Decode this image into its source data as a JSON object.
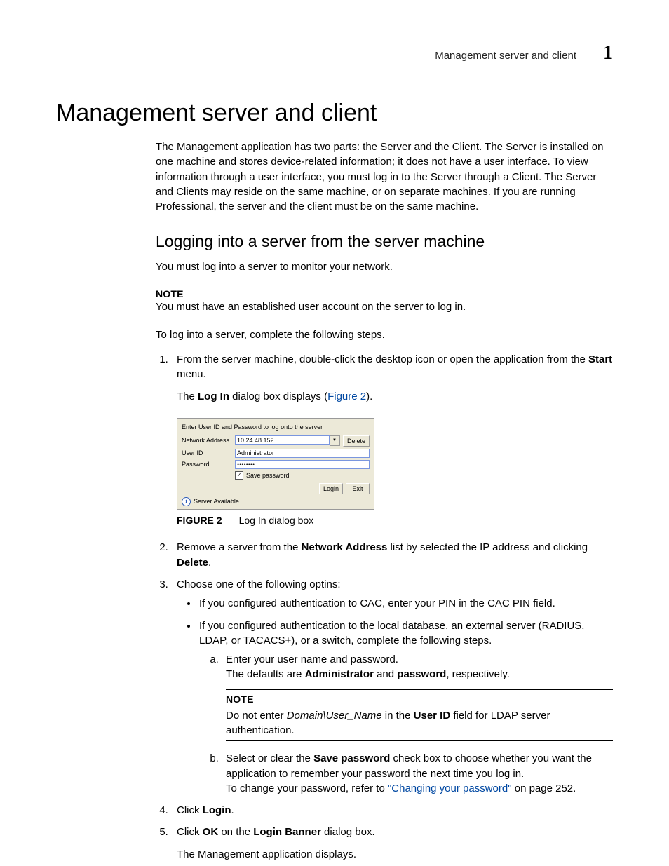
{
  "header": {
    "running_title": "Management server and client",
    "chapter_number": "1"
  },
  "title": "Management server and client",
  "intro": "The Management application has two parts: the Server and the Client. The Server is installed on one machine and stores device-related information; it does not have a user interface. To view information through a user interface, you must log in to the Server through a Client. The Server and Clients may reside on the same machine, or on separate machines. If you are running Professional, the server and the client must be on the same machine.",
  "subhead": "Logging into a server from the server machine",
  "sub_intro": "You must log into a server to monitor your network.",
  "note1": {
    "label": "NOTE",
    "text": "You must have an established user account on the server to log in."
  },
  "pre_steps": "To log into a server, complete the following steps.",
  "step1": {
    "pre": "From the server machine, double-click the desktop icon or open the application from the ",
    "bold": "Start",
    "post": " menu.",
    "sub_pre": "The ",
    "sub_bold": "Log In",
    "sub_mid": " dialog box displays (",
    "sub_link": "Figure 2",
    "sub_post": ")."
  },
  "dialog": {
    "prompt": "Enter User ID and Password to log onto the server",
    "labels": {
      "addr": "Network Address",
      "user": "User ID",
      "pass": "Password"
    },
    "values": {
      "addr": "10.24.48.152",
      "user": "Administrator",
      "pass": "••••••••"
    },
    "buttons": {
      "delete": "Delete",
      "login": "Login",
      "exit": "Exit"
    },
    "save_pw": "Save password",
    "status": "Server Available"
  },
  "figure": {
    "label": "FIGURE 2",
    "caption": "Log In dialog box"
  },
  "step2": {
    "pre": "Remove a server from the ",
    "b1": "Network Address",
    "mid": " list by selected the IP address and clicking ",
    "b2": "Delete",
    "post": "."
  },
  "step3": {
    "text": "Choose one of the following optins:",
    "bullet1": "If you configured authentication to CAC, enter your PIN in the CAC PIN field.",
    "bullet2": "If you configured authentication to the local database, an external server (RADIUS, LDAP, or TACACS+), or a switch, complete the following steps.",
    "a": {
      "l1": "Enter your user name and password.",
      "l2a": "The defaults are ",
      "l2b": "Administrator",
      "l2c": " and ",
      "l2d": "password",
      "l2e": ", respectively."
    },
    "inner_note": {
      "label": "NOTE",
      "pre": "Do not enter ",
      "it": "Domain\\User_Name",
      "mid": " in the ",
      "b": "User ID",
      "post": " field for LDAP server authentication."
    },
    "b": {
      "l1a": "Select or clear the ",
      "l1b": "Save password",
      "l1c": " check box to choose whether you want the application to remember your password the next time you log in.",
      "l2a": "To change your password, refer to ",
      "l2link": "\"Changing your password\"",
      "l2b": " on page 252."
    }
  },
  "step4": {
    "pre": "Click ",
    "b": "Login",
    "post": "."
  },
  "step5": {
    "pre": "Click ",
    "b1": "OK",
    "mid": " on the ",
    "b2": "Login Banner",
    "post": " dialog box.",
    "sub": "The Management application displays."
  }
}
